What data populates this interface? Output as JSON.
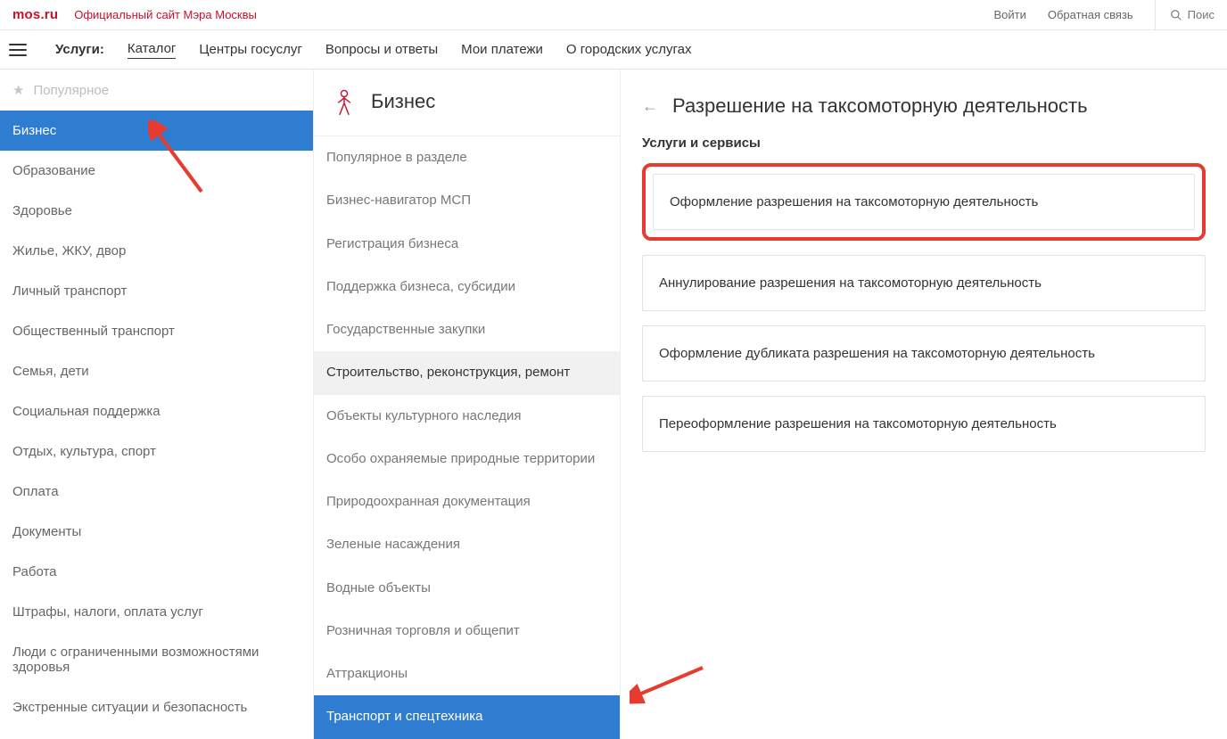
{
  "top": {
    "logo": "mos.ru",
    "slogan": "Официальный сайт Мэра Москвы",
    "login": "Войти",
    "feedback": "Обратная связь",
    "search_placeholder": "Поис"
  },
  "nav": {
    "label": "Услуги:",
    "items": [
      "Каталог",
      "Центры госуслуг",
      "Вопросы и ответы",
      "Мои платежи",
      "О городских услугах"
    ],
    "active": 0
  },
  "categories": [
    "Популярное",
    "Бизнес",
    "Образование",
    "Здоровье",
    "Жилье, ЖКУ, двор",
    "Личный транспорт",
    "Общественный транспорт",
    "Семья, дети",
    "Социальная поддержка",
    "Отдых, культура, спорт",
    "Оплата",
    "Документы",
    "Работа",
    "Штрафы, налоги, оплата услуг",
    "Люди с ограниченными возможностями здоровья",
    "Экстренные ситуации и безопасность"
  ],
  "categories_active": 1,
  "section_title": "Бизнес",
  "subcats": [
    "Популярное в разделе",
    "Бизнес-навигатор МСП",
    "Регистрация бизнеса",
    "Поддержка бизнеса, субсидии",
    "Государственные закупки",
    "Строительство, реконструкция, ремонт",
    "Объекты культурного наследия",
    "Особо охраняемые природные территории",
    "Природоохранная документация",
    "Зеленые насаждения",
    "Водные объекты",
    "Розничная торговля и общепит",
    "Аттракционы",
    "Транспорт и спецтехника"
  ],
  "subcats_hover": 5,
  "subcats_active": 13,
  "right": {
    "title": "Разрешение на таксомоторную деятельность",
    "subtitle": "Услуги и сервисы",
    "services": [
      "Оформление разрешения на таксомоторную деятельность",
      "Аннулирование разрешения на таксомоторную деятельность",
      "Оформление дубликата разрешения на таксомоторную деятельность",
      "Переоформление разрешения на таксомоторную деятельность"
    ],
    "highlight": 0
  }
}
